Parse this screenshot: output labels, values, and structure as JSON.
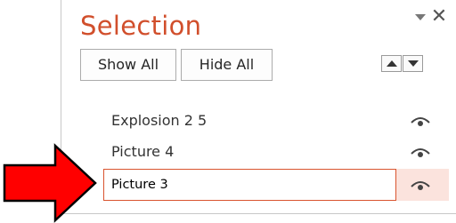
{
  "pane": {
    "title": "Selection",
    "menu_icon": "triangle-down-icon",
    "close_glyph": "✕"
  },
  "toolbar": {
    "show_all_label": "Show All",
    "hide_all_label": "Hide All",
    "bring_forward_icon": "triangle-up-icon",
    "send_backward_icon": "triangle-down-icon"
  },
  "items": [
    {
      "label": "Explosion 2 5",
      "visibility_icon": "eye-icon"
    },
    {
      "label": "Picture 4",
      "visibility_icon": "eye-icon"
    },
    {
      "value": "Picture 3",
      "visibility_icon": "eye-icon",
      "selected": true
    }
  ],
  "colors": {
    "title": "#d14f2c",
    "selected_row_bg": "#fbe3dd",
    "edit_border": "#d9542f",
    "arrow_fill": "#ff0000"
  }
}
